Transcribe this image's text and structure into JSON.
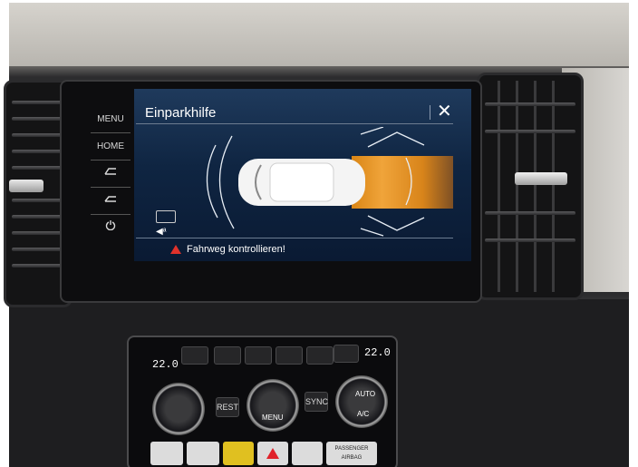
{
  "screen": {
    "title": "Einparkhilfe",
    "close_symbol": "✕",
    "warning": "Fahrweg kontrollieren!",
    "side_buttons": [
      {
        "label": "MENU"
      },
      {
        "label": "HOME"
      },
      {
        "label": "",
        "icon": "park-assist-front-icon"
      },
      {
        "label": "",
        "icon": "park-assist-rear-icon"
      },
      {
        "label": "",
        "icon": "power-icon"
      }
    ],
    "accent_color": "#e89a2c"
  },
  "climate": {
    "temp_left": "22.0",
    "temp_right": "22.0",
    "buttons": [
      {
        "label": "REST"
      },
      {
        "label": "MENU"
      },
      {
        "label": "SYNC"
      },
      {
        "label": "AUTO"
      },
      {
        "label": "A/C"
      }
    ],
    "lower_buttons": [
      {
        "label": "PASSENGER AIRBAG"
      }
    ]
  }
}
